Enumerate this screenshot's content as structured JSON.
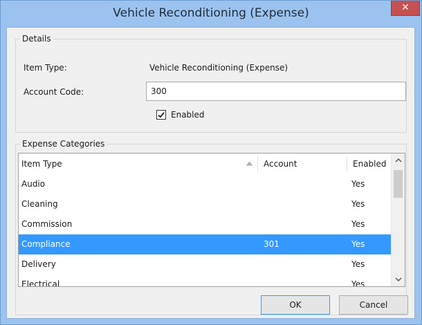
{
  "window": {
    "title": "Vehicle Reconditioning (Expense)",
    "close_glyph": "✕"
  },
  "details": {
    "group_title": "Details",
    "item_type_label": "Item Type:",
    "item_type_value": "Vehicle Reconditioning (Expense)",
    "account_code_label": "Account Code:",
    "account_code_value": "300",
    "enabled_label": "Enabled",
    "enabled_checked": true
  },
  "categories": {
    "group_title": "Expense Categories",
    "columns": [
      "Item Type",
      "Account",
      "Enabled"
    ],
    "sorted_column": "Item Type",
    "sort_direction": "ascending",
    "rows": [
      {
        "item_type": "Audio",
        "account": "",
        "enabled": "Yes"
      },
      {
        "item_type": "Cleaning",
        "account": "",
        "enabled": "Yes"
      },
      {
        "item_type": "Commission",
        "account": "",
        "enabled": "Yes"
      },
      {
        "item_type": "Compliance",
        "account": "301",
        "enabled": "Yes"
      },
      {
        "item_type": "Delivery",
        "account": "",
        "enabled": "Yes"
      },
      {
        "item_type": "Electrical",
        "account": "",
        "enabled": "Yes"
      }
    ],
    "selected_row": 3
  },
  "buttons": {
    "ok_label": "OK",
    "cancel_label": "Cancel"
  },
  "colors": {
    "titlebar": "#9cc3ef",
    "close_button": "#c75050",
    "selection": "#3399ff",
    "dialog_background": "#f0f0f0"
  }
}
